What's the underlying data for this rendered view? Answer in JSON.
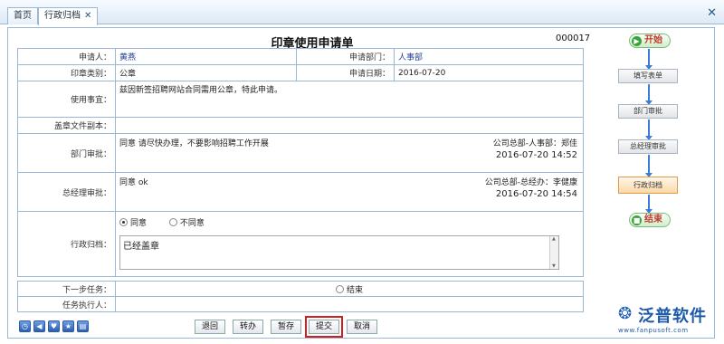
{
  "tabs": [
    {
      "label": "首页"
    },
    {
      "label": "行政归档"
    }
  ],
  "form": {
    "title": "印章使用申请单",
    "number": "000017",
    "applicant_label": "申请人：",
    "applicant": "黄燕",
    "dept_label": "申请部门：",
    "dept": "人事部",
    "seal_type_label": "印章类别：",
    "seal_type": "公章",
    "date_label": "申请日期：",
    "date": "2016-07-20",
    "purpose_label": "使用事宜：",
    "purpose": "兹因新签招聘网站合同需用公章，特此申请。",
    "copy_label": "盖章文件副本：",
    "copy": "",
    "dept_review_label": "部门审批：",
    "dept_review": {
      "text": "同意  请尽快办理，不要影响招聘工作开展",
      "who": "公司总部-人事部：郑佳",
      "time": "2016-07-20 14:52"
    },
    "gm_review_label": "总经理审批：",
    "gm_review": {
      "text": "同意  ok",
      "who": "公司总部-总经办：李健康",
      "time": "2016-07-20 14:54"
    },
    "archive_label": "行政归档：",
    "archive": {
      "agree": "同意",
      "disagree": "不同意",
      "remark": "已经盖章"
    },
    "next_task_label": "下一步任务：",
    "next_task": "结束",
    "executor_label": "任务执行人：",
    "executor": ""
  },
  "buttons": {
    "back": "退回",
    "transfer": "转办",
    "save": "暂存",
    "submit": "提交",
    "cancel": "取消"
  },
  "flow": {
    "start": "开始",
    "fill": "填写表单",
    "dept": "部门审批",
    "gm": "总经理审批",
    "archive": "行政归档",
    "end": "结束"
  },
  "logo": {
    "name": "泛普软件",
    "url": "www.fanpusoft.com"
  }
}
